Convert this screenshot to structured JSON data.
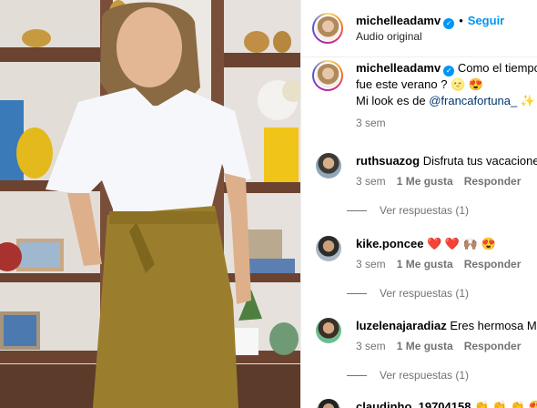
{
  "post": {
    "username": "michelleadamv",
    "follow_label": "Seguir",
    "audio": "Audio original",
    "caption_line1": "Como el tiempo e",
    "caption_line2": "fue este verano ? 🌝 😍",
    "caption_line3_prefix": "Mi look es de ",
    "caption_mention": "@francafortuna_",
    "caption_line3_suffix": " ✨",
    "time": "3 sem"
  },
  "comments": [
    {
      "username": "ruthsuazog",
      "text": "Disfruta tus vacaciones!",
      "time": "3 sem",
      "likes": "1 Me gusta",
      "reply": "Responder",
      "view_replies": "Ver respuestas (1)"
    },
    {
      "username": "kike.poncee",
      "text": "❤️ ❤️ 🙌🏽 😍",
      "time": "3 sem",
      "likes": "1 Me gusta",
      "reply": "Responder",
      "view_replies": "Ver respuestas (1)"
    },
    {
      "username": "luzelenajaradiaz",
      "text": "Eres hermosa Mich",
      "time": "3 sem",
      "likes": "1 Me gusta",
      "reply": "Responder",
      "view_replies": "Ver respuestas (1)"
    },
    {
      "username": "claudinho_19704158",
      "text": "👏 👏 👏 😍 👏"
    }
  ],
  "icons": {
    "verified": "verified-badge-icon"
  },
  "colors": {
    "link_blue": "#0095f6",
    "mention": "#00376b",
    "muted": "#737373"
  }
}
